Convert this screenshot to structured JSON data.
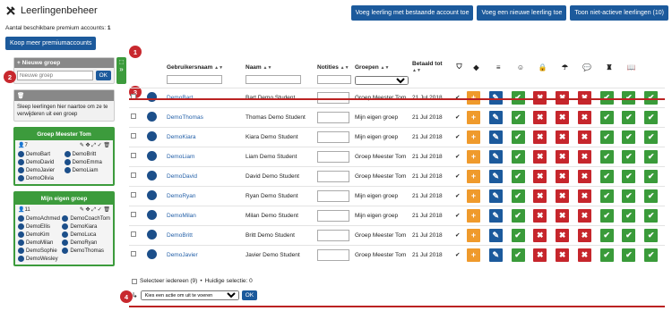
{
  "header": {
    "title": "Leerlingenbeheer",
    "buttons": [
      "Voeg leerling met bestaande account toe",
      "Voeg een nieuwe leerling toe",
      "Toon niet-actieve leerlingen (10)"
    ]
  },
  "premium": {
    "label": "Aantal beschikbare premium accounts:",
    "count": "1",
    "buy": "Koop meer premiumaccounts"
  },
  "newgroup": {
    "title": "Nieuwe groep",
    "placeholder": "Nieuwe groep",
    "ok": "OK"
  },
  "removebox": {
    "text": "Sleep leerlingen hier naartoe om ze te verwijderen uit een groep"
  },
  "groups": [
    {
      "name": "Groep Meester Tom",
      "count": "7",
      "members": [
        "DemoBart",
        "DemoBritt",
        "DemoDavid",
        "DemoEmma",
        "DemoJavier",
        "DemoLiam",
        "DemoOlivia"
      ]
    },
    {
      "name": "Mijn eigen groep",
      "count": "11",
      "members": [
        "DemoAchmed",
        "DemoCoachTom",
        "DemoEllis",
        "DemoKiara",
        "DemoKim",
        "DemoLuca",
        "DemoMilan",
        "DemoRyan",
        "DemoSophie",
        "DemoThomas",
        "DemoWesley"
      ]
    }
  ],
  "badges": [
    "1",
    "2",
    "3",
    "4"
  ],
  "table": {
    "headers": [
      "Gebruikersnaam",
      "Naam",
      "Notities",
      "Groepen",
      "Betaald tot"
    ],
    "rows": [
      {
        "username": "DemoBart",
        "name": "Bart Demo Student",
        "group": "Groep Meester Tom",
        "paid": "21 Jul 2018"
      },
      {
        "username": "DemoThomas",
        "name": "Thomas Demo Student",
        "group": "Mijn eigen groep",
        "paid": "21 Jul 2018"
      },
      {
        "username": "DemoKiara",
        "name": "Kiara Demo Student",
        "group": "Mijn eigen groep",
        "paid": "21 Jul 2018"
      },
      {
        "username": "DemoLiam",
        "name": "Liam Demo Student",
        "group": "Groep Meester Tom",
        "paid": "21 Jul 2018"
      },
      {
        "username": "DemoDavid",
        "name": "David Demo Student",
        "group": "Groep Meester Tom",
        "paid": "21 Jul 2018"
      },
      {
        "username": "DemoRyan",
        "name": "Ryan Demo Student",
        "group": "Mijn eigen groep",
        "paid": "21 Jul 2018"
      },
      {
        "username": "DemoMilan",
        "name": "Milan Demo Student",
        "group": "Mijn eigen groep",
        "paid": "21 Jul 2018"
      },
      {
        "username": "DemoBritt",
        "name": "Britt Demo Student",
        "group": "Groep Meester Tom",
        "paid": "21 Jul 2018"
      },
      {
        "username": "DemoJavier",
        "name": "Javier Demo Student",
        "group": "Groep Meester Tom",
        "paid": "21 Jul 2018"
      }
    ]
  },
  "footer": {
    "selectall": "Selecteer iedereen (9)",
    "bullet": "•",
    "selection": "Huidige selectie: 0",
    "action": "Kies een actie om uit te voeren",
    "ok": "OK"
  }
}
